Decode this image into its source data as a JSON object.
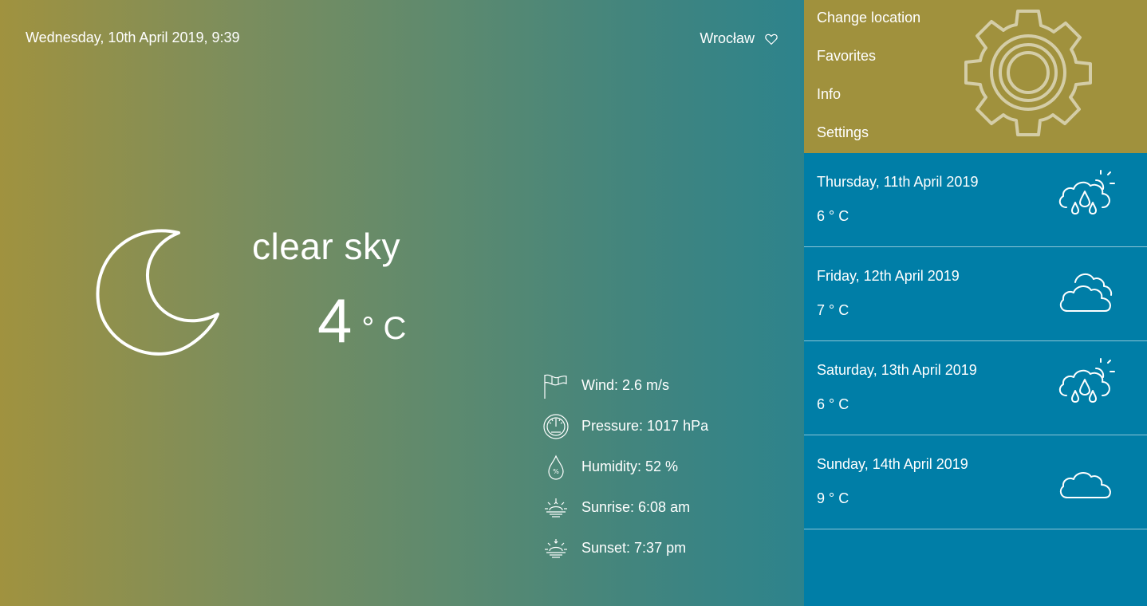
{
  "header": {
    "datetime": "Wednesday, 10th April 2019, 9:39",
    "location": "Wrocław",
    "favorite_icon": "heart-icon"
  },
  "current": {
    "icon": "moon-icon",
    "description": "clear sky",
    "temperature": "4",
    "unit": "° C",
    "details": [
      {
        "icon": "wind-flag-icon",
        "text": "Wind: 2.6 m/s"
      },
      {
        "icon": "pressure-gauge-icon",
        "text": "Pressure: 1017 hPa"
      },
      {
        "icon": "humidity-drop-icon",
        "text": "Humidity: 52 %"
      },
      {
        "icon": "sunrise-icon",
        "text": "Sunrise: 6:08 am"
      },
      {
        "icon": "sunset-icon",
        "text": "Sunset: 7:37 pm"
      }
    ]
  },
  "menu": {
    "items": [
      {
        "label": "Change location"
      },
      {
        "label": "Favorites"
      },
      {
        "label": "Info"
      },
      {
        "label": "Settings"
      }
    ],
    "icon": "gear-icon"
  },
  "forecast": [
    {
      "date": "Thursday, 11th April 2019",
      "temp": "6 ° C",
      "icon": "cloud-rain-sun-icon"
    },
    {
      "date": "Friday, 12th April 2019",
      "temp": "7 ° C",
      "icon": "clouds-icon"
    },
    {
      "date": "Saturday, 13th April 2019",
      "temp": "6 ° C",
      "icon": "cloud-rain-sun-icon"
    },
    {
      "date": "Sunday, 14th April 2019",
      "temp": "9 ° C",
      "icon": "cloud-icon"
    }
  ],
  "colors": {
    "sidebar_bg": "#007ea7",
    "menu_bg": "#a0913d",
    "gradient_start": "#a0923f",
    "gradient_end": "#2d838c"
  }
}
